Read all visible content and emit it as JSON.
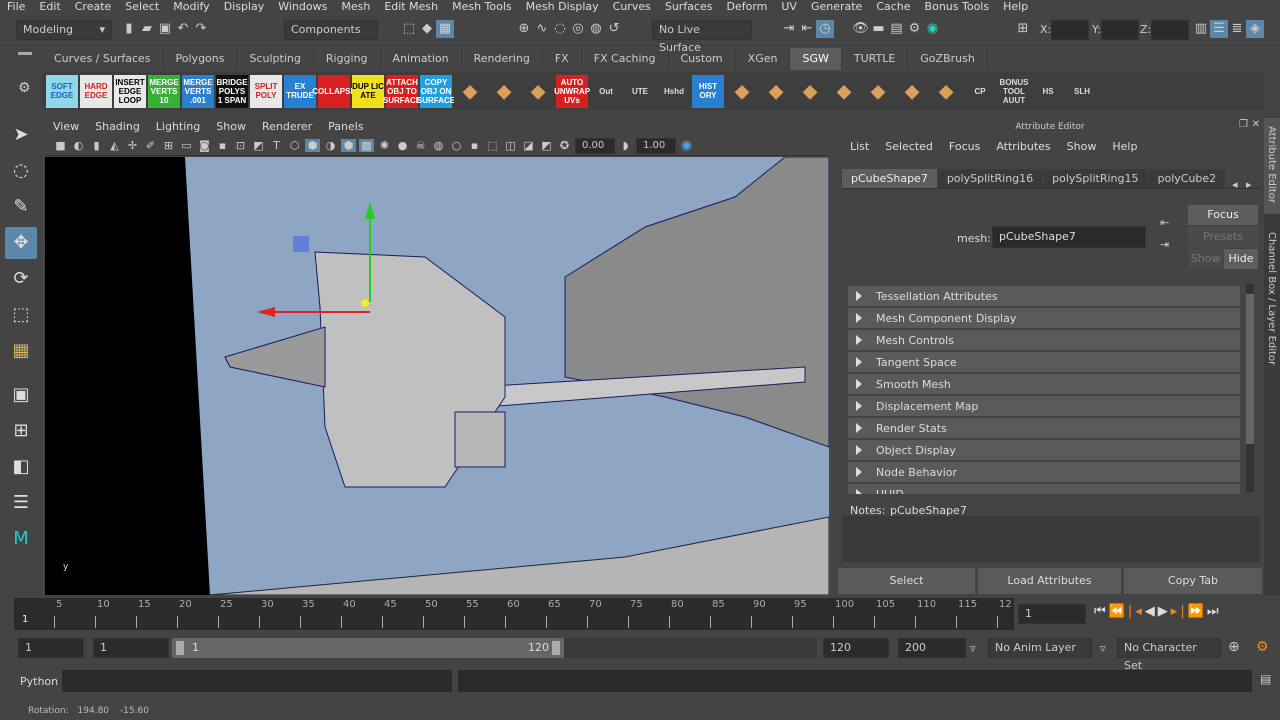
{
  "menubar": [
    "File",
    "Edit",
    "Create",
    "Select",
    "Modify",
    "Display",
    "Windows",
    "Mesh",
    "Edit Mesh",
    "Mesh Tools",
    "Mesh Display",
    "Curves",
    "Surfaces",
    "Deform",
    "UV",
    "Generate",
    "Cache",
    "Bonus Tools",
    "Help"
  ],
  "status": {
    "mode": "Modeling",
    "selection_mode": "Components",
    "live_surface": "No Live Surface",
    "x_label": "X:",
    "y_label": "Y:",
    "z_label": "Z:"
  },
  "shelf_tabs": [
    "Curves / Surfaces",
    "Polygons",
    "Sculpting",
    "Rigging",
    "Animation",
    "Rendering",
    "FX",
    "FX Caching",
    "Custom",
    "XGen",
    "SGW",
    "TURTLE",
    "GoZBrush"
  ],
  "shelf_active": "SGW",
  "shelf_buttons": [
    {
      "label": "SOFT EDGE",
      "bg": "#8fd8e8",
      "fg": "#2060c0"
    },
    {
      "label": "HARD EDGE",
      "bg": "#e8e8e8",
      "fg": "#d02020"
    },
    {
      "label": "INSERT EDGE LOOP",
      "bg": "#e8e8e8",
      "fg": "#000"
    },
    {
      "label": "MERGE VERTS 10",
      "bg": "#38b038",
      "fg": "#fff"
    },
    {
      "label": "MERGE VERTS .001",
      "bg": "#2a80d0",
      "fg": "#fff"
    },
    {
      "label": "BRIDGE POLYS 1 SPAN",
      "bg": "#111",
      "fg": "#fff"
    },
    {
      "label": "SPLIT POLY",
      "bg": "#e8e8e8",
      "fg": "#d02020"
    },
    {
      "label": "EX TRUDE",
      "bg": "#2a80d0",
      "fg": "#fff"
    },
    {
      "label": "COLLAPSE",
      "bg": "#d82020",
      "fg": "#fff"
    },
    {
      "label": "DUP LIC ATE",
      "bg": "#f0e020",
      "fg": "#000"
    },
    {
      "label": "ATTACH OBJ TO SURFACE",
      "bg": "#d82020",
      "fg": "#fff"
    },
    {
      "label": "COPY OBJ ON SURFACE",
      "bg": "#20a0e0",
      "fg": "#fff"
    },
    {
      "label": "",
      "bg": "#3e3e3e",
      "fg": "#fff"
    },
    {
      "label": "",
      "bg": "#3e3e3e",
      "fg": "#fff"
    },
    {
      "label": "",
      "bg": "#3e3e3e",
      "fg": "#fff"
    },
    {
      "label": "AUTO UNWRAP UVs",
      "bg": "#d82020",
      "fg": "#fff"
    },
    {
      "label": "Out",
      "bg": "#3e3e3e",
      "fg": "#ddd"
    },
    {
      "label": "UTE",
      "bg": "#3e3e3e",
      "fg": "#ddd"
    },
    {
      "label": "Hshd",
      "bg": "#3e3e3e",
      "fg": "#ddd"
    },
    {
      "label": "HIST ORY",
      "bg": "#2a80d0",
      "fg": "#fff"
    },
    {
      "label": "",
      "bg": "#3e3e3e",
      "fg": "#fff"
    },
    {
      "label": "",
      "bg": "#3e3e3e",
      "fg": "#fff"
    },
    {
      "label": "",
      "bg": "#3e3e3e",
      "fg": "#fff"
    },
    {
      "label": "",
      "bg": "#3e3e3e",
      "fg": "#fff"
    },
    {
      "label": "",
      "bg": "#3e3e3e",
      "fg": "#fff"
    },
    {
      "label": "",
      "bg": "#3e3e3e",
      "fg": "#fff"
    },
    {
      "label": "",
      "bg": "#3e3e3e",
      "fg": "#fff"
    },
    {
      "label": "CP",
      "bg": "#3e3e3e",
      "fg": "#ddd"
    },
    {
      "label": "BONUS TOOL AUUT",
      "bg": "#3e3e3e",
      "fg": "#ddd"
    },
    {
      "label": "HS",
      "bg": "#3e3e3e",
      "fg": "#ddd"
    },
    {
      "label": "SLH",
      "bg": "#3e3e3e",
      "fg": "#ddd"
    }
  ],
  "viewport": {
    "menu": [
      "View",
      "Shading",
      "Lighting",
      "Show",
      "Renderer",
      "Panels"
    ],
    "exposure": "0.00",
    "gamma": "1.00",
    "bg_color": "#8ea6c4"
  },
  "attribute_editor": {
    "title": "Attribute Editor",
    "menu": [
      "List",
      "Selected",
      "Focus",
      "Attributes",
      "Show",
      "Help"
    ],
    "tabs": [
      "pCubeShape7",
      "polySplitRing16",
      "polySplitRing15",
      "polyCube2"
    ],
    "mesh_label": "mesh:",
    "mesh_value": "pCubeShape7",
    "focus": "Focus",
    "presets": "Presets",
    "show": "Show",
    "hide": "Hide",
    "sections": [
      "Tessellation Attributes",
      "Mesh Component Display",
      "Mesh Controls",
      "Tangent Space",
      "Smooth Mesh",
      "Displacement Map",
      "Render Stats",
      "Object Display",
      "Node Behavior",
      "UUID"
    ],
    "notes_label": "Notes:",
    "notes_value": "pCubeShape7",
    "buttons": [
      "Select",
      "Load Attributes",
      "Copy Tab"
    ]
  },
  "side_tabs": [
    "Attribute Editor",
    "Channel Box / Layer Editor"
  ],
  "timeline": {
    "ticks": [
      "5",
      "10",
      "15",
      "20",
      "25",
      "30",
      "35",
      "40",
      "45",
      "50",
      "55",
      "60",
      "65",
      "70",
      "75",
      "80",
      "85",
      "90",
      "95",
      "100",
      "105",
      "110",
      "115",
      "12"
    ],
    "current_frame_marker": "1",
    "current_frame": "1"
  },
  "range": {
    "start": "1",
    "playback_start": "1",
    "slider_start": "1",
    "slider_end": "120",
    "playback_end": "120",
    "end": "200",
    "anim_layer": "No Anim Layer",
    "character_set": "No Character Set"
  },
  "command": {
    "language": "Python"
  },
  "help_line": {
    "label": "Rotation:",
    "v1": "194.80",
    "v2": "-15.60"
  }
}
